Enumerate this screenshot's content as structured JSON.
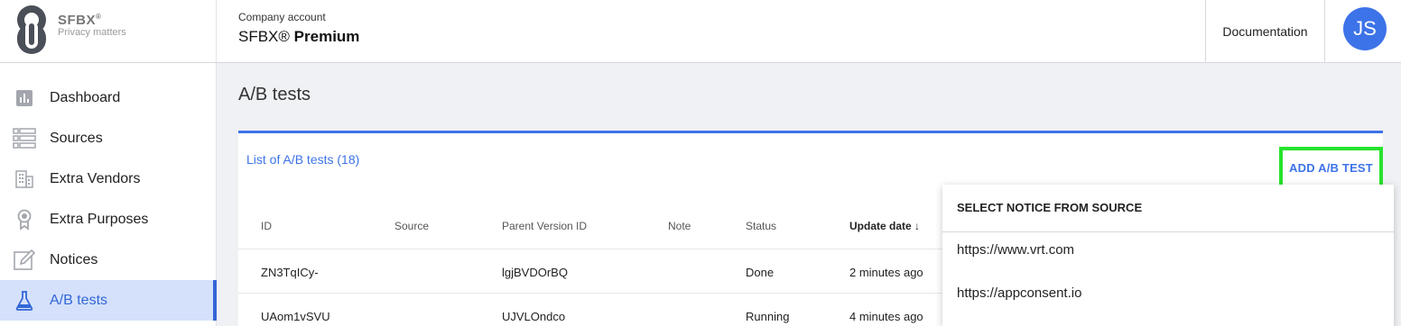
{
  "brand": {
    "name": "SFBX",
    "registered": "®",
    "tagline": "Privacy matters"
  },
  "account": {
    "label": "Company account",
    "name_prefix": "SFBX®",
    "name_plan": "Premium"
  },
  "header": {
    "documentation": "Documentation",
    "avatar_initials": "JS"
  },
  "sidebar": {
    "items": [
      {
        "label": "Dashboard",
        "icon": "bar-chart-icon"
      },
      {
        "label": "Sources",
        "icon": "list-icon"
      },
      {
        "label": "Extra Vendors",
        "icon": "building-icon"
      },
      {
        "label": "Extra Purposes",
        "icon": "ribbon-icon"
      },
      {
        "label": "Notices",
        "icon": "edit-icon"
      },
      {
        "label": "A/B tests",
        "icon": "flask-icon",
        "active": true
      }
    ]
  },
  "main": {
    "title": "A/B tests",
    "card_title": "List of A/B tests (18)",
    "add_button": "ADD A/B TEST",
    "columns": [
      "ID",
      "Source",
      "Parent Version ID",
      "Note",
      "Status",
      "Update date"
    ],
    "sort_indicator": "↓",
    "rows": [
      {
        "id": "ZN3TqICy-",
        "source": "",
        "parent": "lgjBVDOrBQ",
        "note": "",
        "status": "Done",
        "updated": "2 minutes ago"
      },
      {
        "id": "UAom1vSVU",
        "source": "",
        "parent": "UJVLOndco",
        "note": "",
        "status": "Running",
        "updated": "4 minutes ago"
      }
    ]
  },
  "dropdown": {
    "title": "SELECT NOTICE FROM SOURCE",
    "options": [
      "https://www.vrt.com",
      "https://appconsent.io"
    ]
  },
  "colors": {
    "accent": "#3d73e8",
    "highlight": "#27e32d",
    "active_bg": "#d5e1fb"
  }
}
